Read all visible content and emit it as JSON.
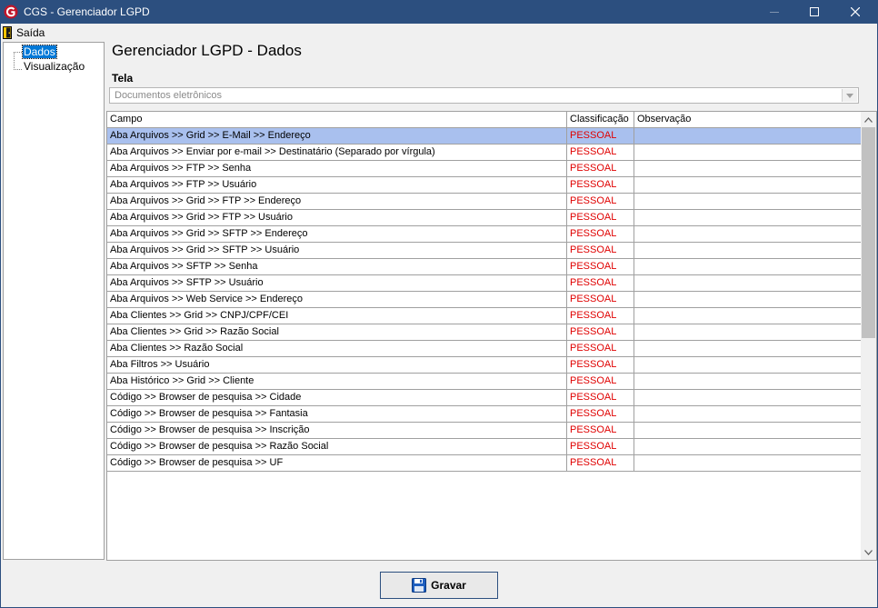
{
  "window": {
    "title": "CGS - Gerenciador LGPD",
    "minimize_icon": "minimize-icon",
    "maximize_icon": "maximize-icon",
    "close_icon": "close-icon"
  },
  "menu": {
    "items": [
      {
        "label": "Saída",
        "icon": "exit-door-icon"
      }
    ]
  },
  "tree": {
    "items": [
      {
        "label": "Dados",
        "selected": true
      },
      {
        "label": "Visualização",
        "selected": false
      }
    ]
  },
  "main": {
    "heading": "Gerenciador LGPD - Dados",
    "tela_label": "Tela",
    "tela_value": "Documentos eletrônicos"
  },
  "grid": {
    "columns": [
      "Campo",
      "Classificação",
      "Observação"
    ],
    "rows": [
      {
        "campo": "Aba Arquivos  >> Grid >> E-Mail >> Endereço",
        "classificacao": "PESSOAL",
        "observacao": "",
        "selected": true
      },
      {
        "campo": "Aba Arquivos >> Enviar por e-mail >> Destinatário (Separado por vírgula)",
        "classificacao": "PESSOAL",
        "observacao": ""
      },
      {
        "campo": "Aba Arquivos >> FTP >> Senha",
        "classificacao": "PESSOAL",
        "observacao": ""
      },
      {
        "campo": "Aba Arquivos >> FTP >> Usuário",
        "classificacao": "PESSOAL",
        "observacao": ""
      },
      {
        "campo": "Aba Arquivos >> Grid >> FTP >>  Endereço",
        "classificacao": "PESSOAL",
        "observacao": ""
      },
      {
        "campo": "Aba Arquivos >> Grid >> FTP >> Usuário",
        "classificacao": "PESSOAL",
        "observacao": ""
      },
      {
        "campo": "Aba Arquivos >> Grid >> SFTP >> Endereço",
        "classificacao": "PESSOAL",
        "observacao": ""
      },
      {
        "campo": "Aba Arquivos >> Grid >> SFTP >> Usuário",
        "classificacao": "PESSOAL",
        "observacao": ""
      },
      {
        "campo": "Aba Arquivos >> SFTP >> Senha",
        "classificacao": "PESSOAL",
        "observacao": ""
      },
      {
        "campo": "Aba Arquivos >> SFTP >> Usuário",
        "classificacao": "PESSOAL",
        "observacao": ""
      },
      {
        "campo": "Aba Arquivos >> Web Service >> Endereço",
        "classificacao": "PESSOAL",
        "observacao": ""
      },
      {
        "campo": "Aba Clientes >> Grid >> CNPJ/CPF/CEI",
        "classificacao": "PESSOAL",
        "observacao": ""
      },
      {
        "campo": "Aba Clientes >> Grid >> Razão Social",
        "classificacao": "PESSOAL",
        "observacao": ""
      },
      {
        "campo": "Aba Clientes >> Razão Social",
        "classificacao": "PESSOAL",
        "observacao": ""
      },
      {
        "campo": "Aba Filtros >> Usuário",
        "classificacao": "PESSOAL",
        "observacao": ""
      },
      {
        "campo": "Aba Histórico >> Grid >> Cliente",
        "classificacao": "PESSOAL",
        "observacao": ""
      },
      {
        "campo": "Código >> Browser de pesquisa >> Cidade",
        "classificacao": "PESSOAL",
        "observacao": ""
      },
      {
        "campo": "Código >> Browser de pesquisa >> Fantasia",
        "classificacao": "PESSOAL",
        "observacao": ""
      },
      {
        "campo": "Código >> Browser de pesquisa >> Inscrição",
        "classificacao": "PESSOAL",
        "observacao": ""
      },
      {
        "campo": "Código >> Browser de pesquisa >> Razão Social",
        "classificacao": "PESSOAL",
        "observacao": ""
      },
      {
        "campo": "Código >> Browser de pesquisa >> UF",
        "classificacao": "PESSOAL",
        "observacao": ""
      }
    ]
  },
  "footer": {
    "save_label": "Gravar",
    "save_icon": "floppy-disk-icon"
  },
  "colors": {
    "titlebar": "#2c4f7f",
    "selection": "#a9c0ee",
    "classification_text": "#e00000"
  }
}
